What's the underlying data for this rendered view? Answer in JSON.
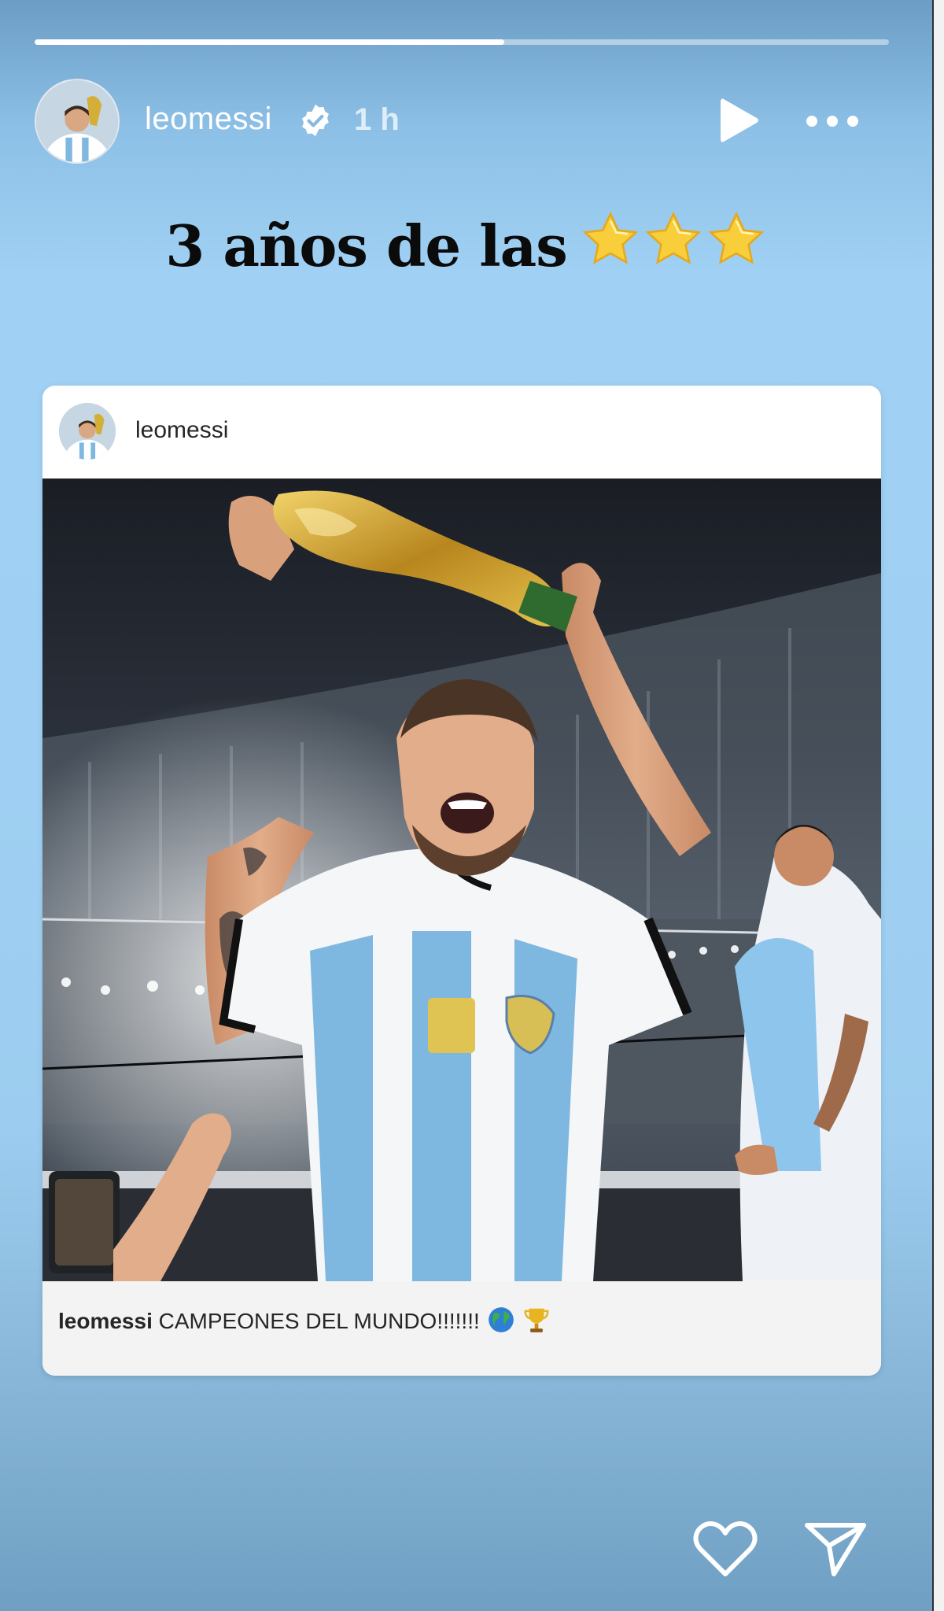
{
  "story": {
    "progress": 0.55,
    "username": "leomessi",
    "verified": true,
    "time": "1 h",
    "play_icon": "play-icon",
    "more_icon": "more-dots-icon",
    "caption_text": "3 años de las",
    "caption_emoji": [
      "star-emoji",
      "star-emoji",
      "star-emoji"
    ]
  },
  "shared_post": {
    "username": "leomessi",
    "multi_media_icon": "carousel-icon",
    "caption_user": "leomessi",
    "caption_text": "CAMPEONES DEL MUNDO!!!!!!!",
    "caption_emoji": [
      "globe-emoji",
      "trophy-emoji"
    ]
  },
  "actions": {
    "like_icon": "heart-icon",
    "share_icon": "send-icon"
  },
  "colors": {
    "background_top": "#6c9ec5",
    "background_mid": "#a0d1f4",
    "text_dark": "#0b0b0b",
    "white": "#ffffff",
    "jersey_blue": "#7eb7e0"
  }
}
